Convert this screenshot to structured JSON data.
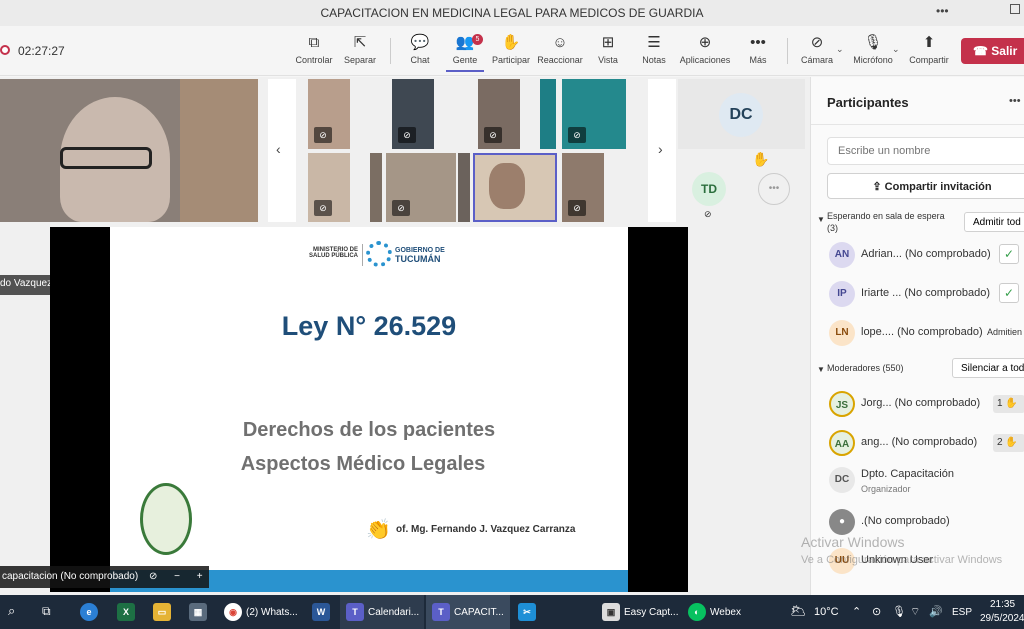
{
  "window": {
    "title": "CAPACITACION EN MEDICINA LEGAL PARA MEDICOS DE GUARDIA"
  },
  "meeting": {
    "timer": "02:27:27"
  },
  "toolbar": {
    "controlar": "Controlar",
    "separar": "Separar",
    "chat": "Chat",
    "gente": "Gente",
    "gente_badge": "5",
    "participar": "Participar",
    "reaccionar": "Reaccionar",
    "vista": "Vista",
    "notas": "Notas",
    "aplicaciones": "Aplicaciones",
    "mas": "Más",
    "camara": "Cámara",
    "microfono": "Micrófono",
    "compartir": "Compartir",
    "salir": "Salir"
  },
  "stage": {
    "speaker_name": "do Vazquez Carranza (No comprobado)",
    "sharer_name": "capacitacion (No comprobado)",
    "tile_dc": "DC",
    "tile_td": "TD"
  },
  "slide": {
    "logo_ministerio_line1": "MINISTERIO DE",
    "logo_ministerio_line2": "SALUD PÚBLICA",
    "logo_gobierno_line1": "GOBIERNO DE",
    "logo_gobierno_line2": "TUCUMÁN",
    "title": "Ley N° 26.529",
    "subtitle1": "Derechos de los pacientes",
    "subtitle2": "Aspectos Médico Legales",
    "author": "of. Mg. Fernando J. Vazquez Carranza"
  },
  "panel": {
    "title": "Participantes",
    "search_placeholder": "Escribe un nombre",
    "share_invite": "Compartir invitación",
    "waiting_header": "Esperando en sala de espera",
    "waiting_count": "(3)",
    "admit_all": "Admitir tod",
    "waiting": [
      {
        "initials": "AN",
        "name": "Adrian... (No comprobado)",
        "color": "#dcd9f0"
      },
      {
        "initials": "IP",
        "name": "Iriarte ... (No comprobado)",
        "color": "#dcd9f0"
      },
      {
        "initials": "LN",
        "name": "lope.... (No comprobado)",
        "action": "Admitien",
        "color": "#fbe4c8"
      }
    ],
    "moderators_header": "Moderadores (550)",
    "mute_all": "Silenciar a tod",
    "moderators": [
      {
        "initials": "JS",
        "name": "Jorg... (No comprobado)",
        "hand": "1",
        "color": "#e6f0e0"
      },
      {
        "initials": "AA",
        "name": "ang... (No comprobado)",
        "hand": "2",
        "color": "#e6f0e0"
      },
      {
        "initials": "DC",
        "name": "Dpto. Capacitación",
        "sub": "Organizador",
        "color": "#e8e8e8"
      },
      {
        "initials": "",
        "name": ".(No comprobado)",
        "color": "#888888"
      },
      {
        "initials": "UU",
        "name": "Unknown User",
        "color": "#fbe4c8"
      }
    ]
  },
  "watermark": {
    "line1": "Activar Windows",
    "line2": "Ve a Configuración para activar Windows"
  },
  "taskbar": {
    "whatsapp": "(2) Whats...",
    "calendar": "Calendari...",
    "capacit": "CAPACIT...",
    "easycapt": "Easy Capt...",
    "webex": "Webex",
    "temp": "10°C",
    "lang": "ESP",
    "time": "21:35",
    "date": "29/5/2024"
  },
  "colors": {
    "accent": "#5b5fc7",
    "leave": "#c4314b",
    "slide_title": "#1f4e79",
    "slide_sub": "#707070"
  }
}
